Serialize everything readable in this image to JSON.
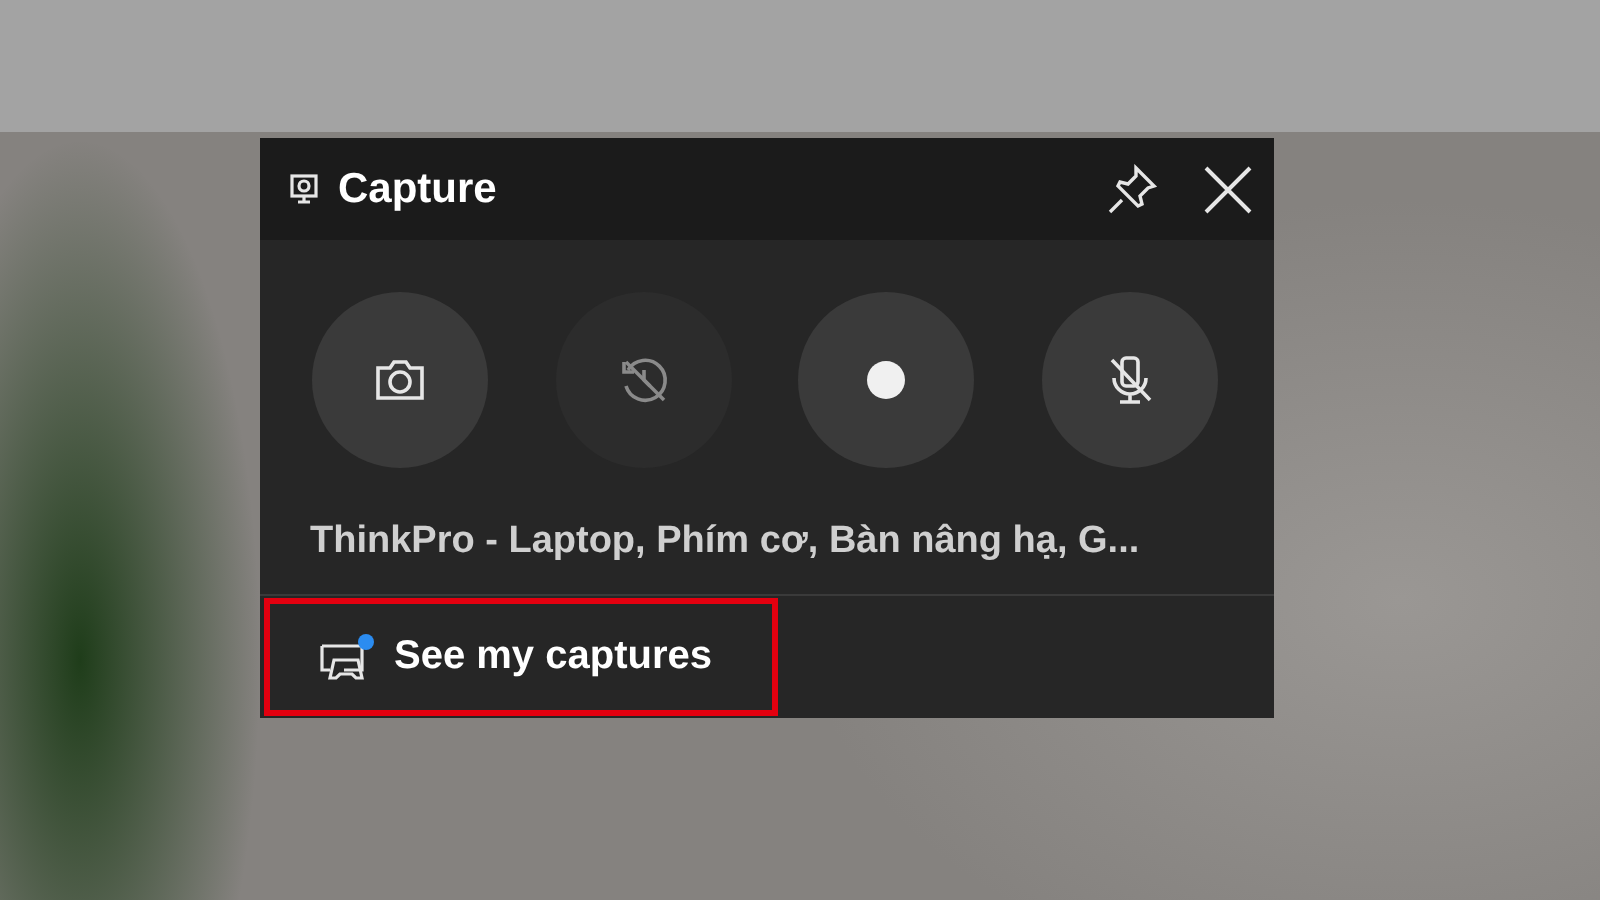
{
  "widget": {
    "title": "Capture",
    "buttons": [
      {
        "kind": "screenshot",
        "disabled": false
      },
      {
        "kind": "record-last",
        "disabled": true
      },
      {
        "kind": "record",
        "disabled": false
      },
      {
        "kind": "mic",
        "disabled": false
      }
    ],
    "app_name": "ThinkPro - Laptop, Phím cơ, Bàn nâng hạ, G...",
    "captures_link": {
      "label": "See my captures",
      "unseen": true,
      "highlighted": true
    }
  }
}
